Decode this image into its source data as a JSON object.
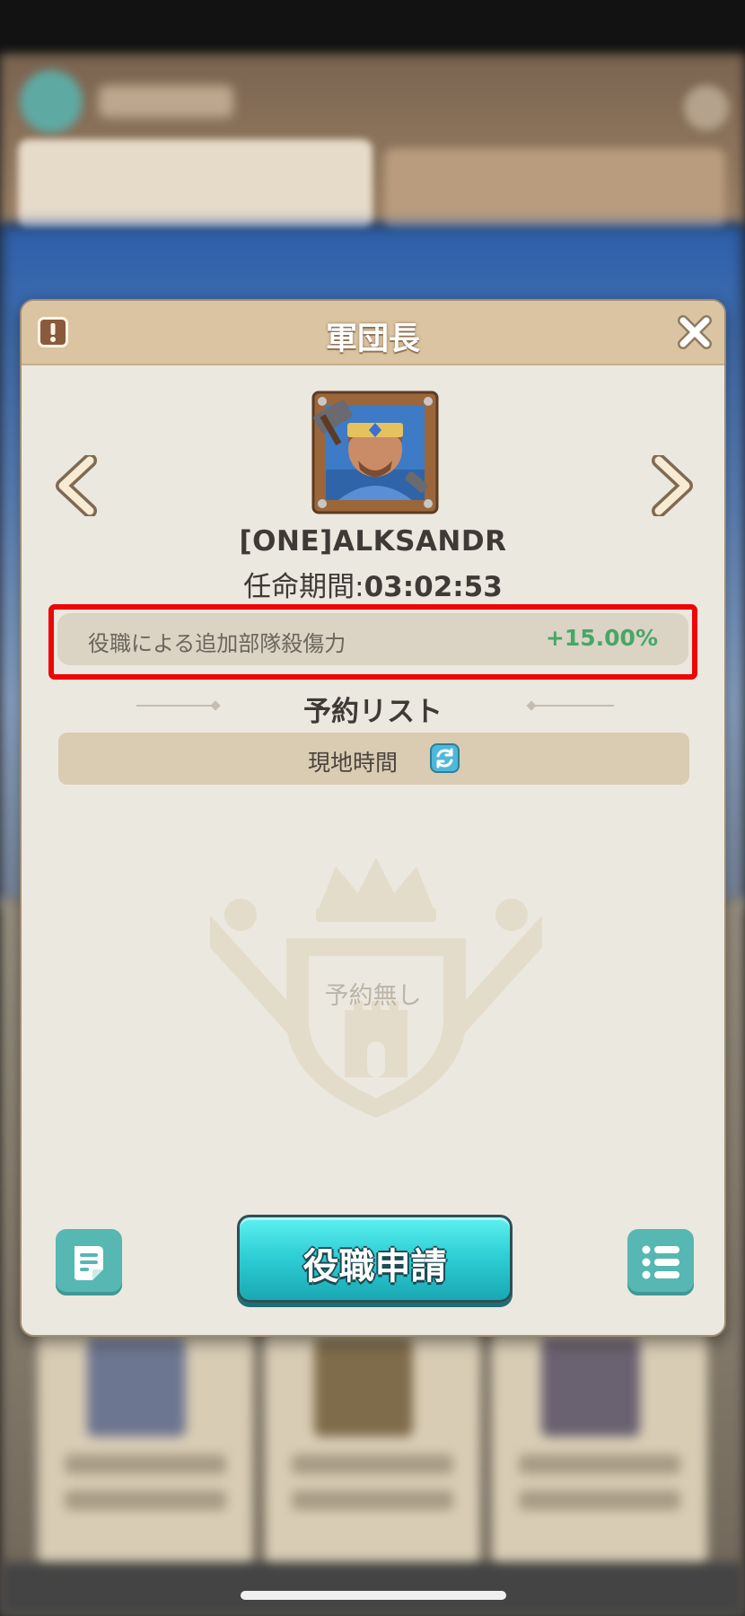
{
  "dialog": {
    "title": "軍団長",
    "player_name": "[ONE]ALKSANDR",
    "term_label": "任命期間:",
    "term_value": "03:02:53",
    "bonus": {
      "label": "役職による追加部隊殺傷力",
      "value": "+15.00%",
      "value_color": "#47a767"
    },
    "reservation_title": "予約リスト",
    "timezone_label": "現地時間",
    "empty_text": "予約無し",
    "apply_button_label": "役職申請"
  },
  "icons": {
    "info": "exclamation-icon",
    "close": "close-icon",
    "prev": "chevron-left-icon",
    "next": "chevron-right-icon",
    "sync": "sync-icon",
    "notes": "notes-icon",
    "list": "list-icon",
    "emblem": "crown-shield-swords-emblem"
  },
  "colors": {
    "accent": "#2fd0d6",
    "highlight_border": "#ee0606",
    "panel": "#ebe8df",
    "header": "#dbc4a1"
  }
}
